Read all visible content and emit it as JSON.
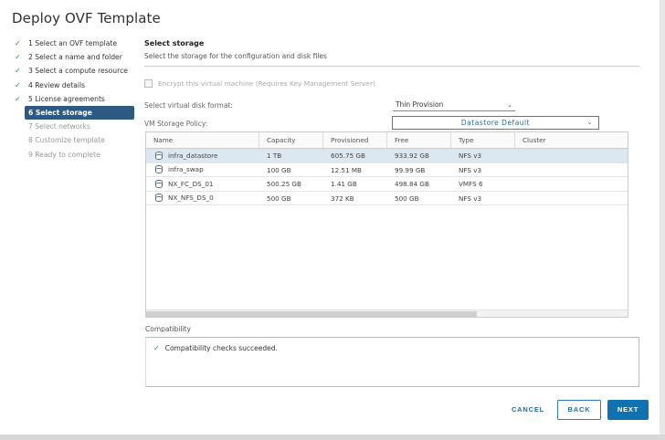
{
  "dialog": {
    "title": "Deploy OVF Template"
  },
  "steps": [
    {
      "label": "1 Select an OVF template",
      "state": "done"
    },
    {
      "label": "2 Select a name and folder",
      "state": "done"
    },
    {
      "label": "3 Select a compute resource",
      "state": "done"
    },
    {
      "label": "4 Review details",
      "state": "done"
    },
    {
      "label": "5 License agreements",
      "state": "done"
    },
    {
      "label": "6 Select storage",
      "state": "active"
    },
    {
      "label": "7 Select networks",
      "state": "disabled"
    },
    {
      "label": "8 Customize template",
      "state": "disabled"
    },
    {
      "label": "9 Ready to complete",
      "state": "disabled"
    }
  ],
  "main": {
    "section_title": "Select storage",
    "section_subtitle": "Select the storage for the configuration and disk files",
    "encrypt_label": "Encrypt this virtual machine (Requires Key Management Server)",
    "disk_format_label": "Select virtual disk format:",
    "disk_format_value": "Thin Provision",
    "storage_policy_label": "VM Storage Policy:",
    "storage_policy_value": "Datastore Default"
  },
  "table": {
    "columns": [
      "Name",
      "Capacity",
      "Provisioned",
      "Free",
      "Type",
      "Cluster"
    ],
    "rows": [
      {
        "name": "infra_datastore",
        "capacity": "1 TB",
        "provisioned": "605.75 GB",
        "free": "933.92 GB",
        "type": "NFS v3",
        "cluster": "",
        "selected": true
      },
      {
        "name": "infra_swap",
        "capacity": "100 GB",
        "provisioned": "12.51 MB",
        "free": "99.99 GB",
        "type": "NFS v3",
        "cluster": "",
        "selected": false
      },
      {
        "name": "NX_FC_DS_01",
        "capacity": "500.25 GB",
        "provisioned": "1.41 GB",
        "free": "498.84 GB",
        "type": "VMFS 6",
        "cluster": "",
        "selected": false
      },
      {
        "name": "NX_NFS_DS_0",
        "capacity": "500 GB",
        "provisioned": "372 KB",
        "free": "500 GB",
        "type": "NFS v3",
        "cluster": "",
        "selected": false
      }
    ]
  },
  "compatibility": {
    "label": "Compatibility",
    "message": "Compatibility checks succeeded."
  },
  "buttons": {
    "cancel": "CANCEL",
    "back": "BACK",
    "next": "NEXT"
  },
  "colors": {
    "accent": "#0f73b1",
    "active_step": "#2d5a83",
    "success": "#2f8f46"
  }
}
